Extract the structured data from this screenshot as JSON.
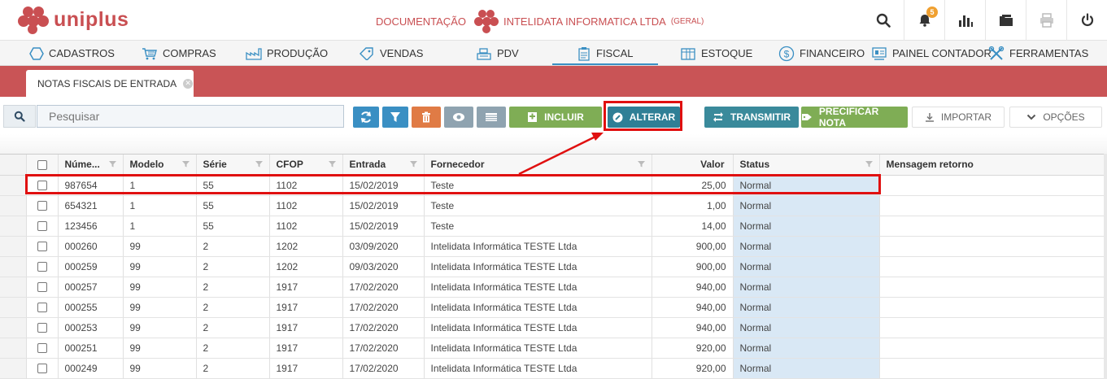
{
  "app": {
    "brand": "uniplus",
    "brand_color": "#c94f52",
    "company_label": "DOCUMENTAÇÃO",
    "company_name": "INTELIDATA INFORMATICA LTDA",
    "company_scope": "(GERAL)",
    "notification_count": "5"
  },
  "menu": [
    {
      "label": "CADASTROS",
      "icon": "hexagon-icon"
    },
    {
      "label": "COMPRAS",
      "icon": "cart-icon"
    },
    {
      "label": "PRODUÇÃO",
      "icon": "factory-icon"
    },
    {
      "label": "VENDAS",
      "icon": "tag-icon"
    },
    {
      "label": "PDV",
      "icon": "register-icon"
    },
    {
      "label": "FISCAL",
      "icon": "clipboard-icon",
      "active": true
    },
    {
      "label": "ESTOQUE",
      "icon": "box-icon"
    },
    {
      "label": "FINANCEIRO",
      "icon": "dollar-icon"
    },
    {
      "label": "PAINEL CONTADOR",
      "icon": "panel-icon"
    },
    {
      "label": "FERRAMENTAS",
      "icon": "tools-icon"
    }
  ],
  "tab": {
    "label": "NOTAS FISCAIS DE ENTRADA"
  },
  "search": {
    "placeholder": "Pesquisar"
  },
  "toolbar": {
    "incluir": "INCLUIR",
    "alterar": "ALTERAR",
    "transmitir": "TRANSMITIR",
    "precificar": "PRECIFICAR NOTA",
    "importar": "IMPORTAR",
    "opcoes": "OPÇÕES",
    "colors": {
      "blue": "#3a8fc3",
      "orange": "#e07b45",
      "gray": "#8fa3b0",
      "green": "#7fad55",
      "teal": "#3a8a9b",
      "dark_teal": "#2f7f96"
    }
  },
  "grid": {
    "columns": [
      "Núme...",
      "Modelo",
      "Série",
      "CFOP",
      "Entrada",
      "Fornecedor",
      "Valor",
      "Status",
      "Mensagem retorno"
    ],
    "rows": [
      [
        "987654",
        "1",
        "55",
        "1102",
        "15/02/2019",
        "Teste",
        "25,00",
        "Normal",
        ""
      ],
      [
        "654321",
        "1",
        "55",
        "1102",
        "15/02/2019",
        "Teste",
        "1,00",
        "Normal",
        ""
      ],
      [
        "123456",
        "1",
        "55",
        "1102",
        "15/02/2019",
        "Teste",
        "14,00",
        "Normal",
        ""
      ],
      [
        "000260",
        "99",
        "2",
        "1202",
        "03/09/2020",
        "Intelidata Informática TESTE Ltda",
        "900,00",
        "Normal",
        ""
      ],
      [
        "000259",
        "99",
        "2",
        "1202",
        "09/03/2020",
        "Intelidata Informática TESTE Ltda",
        "900,00",
        "Normal",
        ""
      ],
      [
        "000257",
        "99",
        "2",
        "1917",
        "17/02/2020",
        "Intelidata Informática TESTE Ltda",
        "940,00",
        "Normal",
        ""
      ],
      [
        "000255",
        "99",
        "2",
        "1917",
        "17/02/2020",
        "Intelidata Informática TESTE Ltda",
        "940,00",
        "Normal",
        ""
      ],
      [
        "000253",
        "99",
        "2",
        "1917",
        "17/02/2020",
        "Intelidata Informática TESTE Ltda",
        "940,00",
        "Normal",
        ""
      ],
      [
        "000251",
        "99",
        "2",
        "1917",
        "17/02/2020",
        "Intelidata Informática TESTE Ltda",
        "920,00",
        "Normal",
        ""
      ],
      [
        "000249",
        "99",
        "2",
        "1917",
        "17/02/2020",
        "Intelidata Informática TESTE Ltda",
        "920,00",
        "Normal",
        ""
      ]
    ]
  }
}
